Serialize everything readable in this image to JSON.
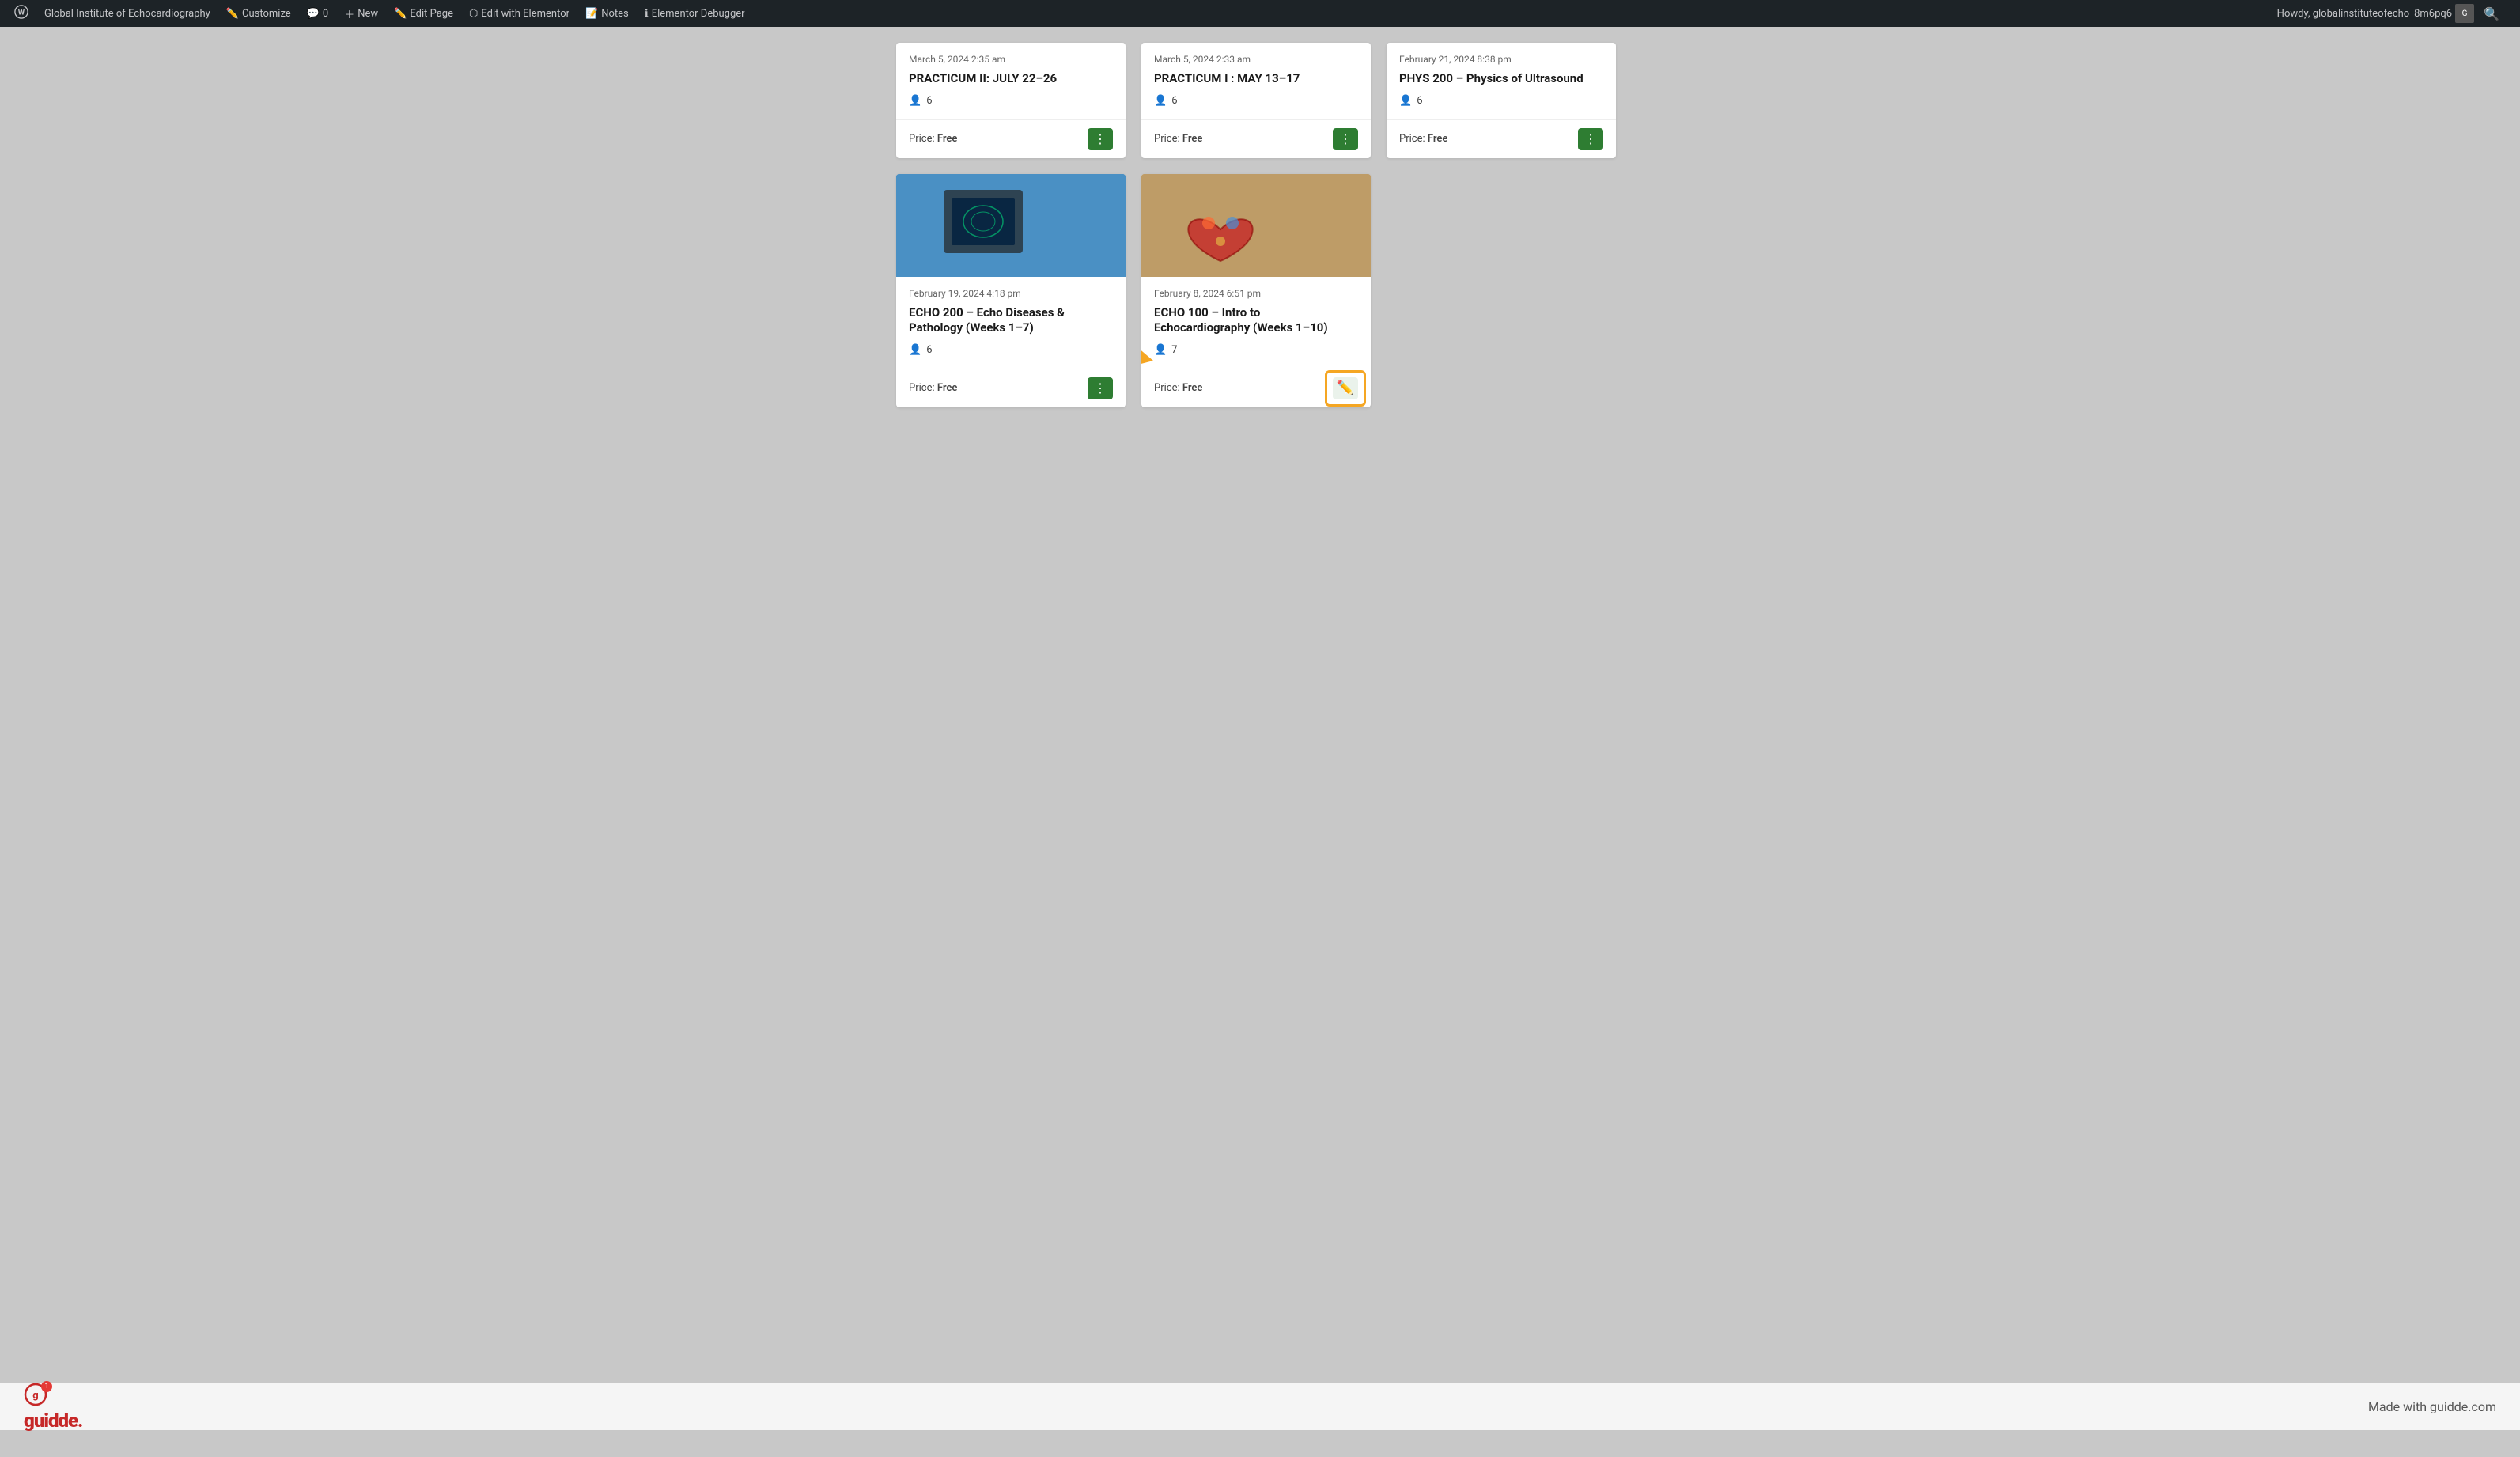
{
  "adminBar": {
    "wpIcon": "W",
    "siteName": "Global Institute of Echocardiography",
    "customize": "Customize",
    "comments": "0",
    "new": "New",
    "editPage": "Edit Page",
    "editWithElementor": "Edit with Elementor",
    "notes": "Notes",
    "elementorDebugger": "Elementor Debugger",
    "userGreeting": "Howdy, globalinstituteofecho_8m6pq6",
    "searchLabel": "Search"
  },
  "courses": {
    "row1": [
      {
        "date": "March 5, 2024 2:35 am",
        "title": "PRACTICUM II: JULY 22–26",
        "students": "6",
        "price": "Free"
      },
      {
        "date": "March 5, 2024 2:33 am",
        "title": "PRACTICUM I : MAY 13–17",
        "students": "6",
        "price": "Free"
      },
      {
        "date": "February 21, 2024 8:38 pm",
        "title": "PHYS 200 – Physics of Ultrasound",
        "students": "6",
        "price": "Free"
      }
    ],
    "row2": [
      {
        "date": "February 19, 2024 4:18 pm",
        "title": "ECHO 200 – Echo Diseases & Pathology (Weeks 1–7)",
        "students": "6",
        "price": "Free",
        "hasImage": true,
        "imageType": "blue"
      },
      {
        "date": "February 8, 2024 6:51 pm",
        "title": "ECHO 100 – Intro to Echocardiography (Weeks 1–10)",
        "students": "7",
        "price": "Free",
        "hasImage": true,
        "imageType": "heart",
        "annotated": true
      }
    ]
  },
  "price_label": "Price:",
  "annotation": {
    "arrow_hint": "highlighted edit button"
  },
  "footer": {
    "guidde": "guidde.",
    "badge": "1",
    "madeWith": "Made with guidde.com"
  }
}
